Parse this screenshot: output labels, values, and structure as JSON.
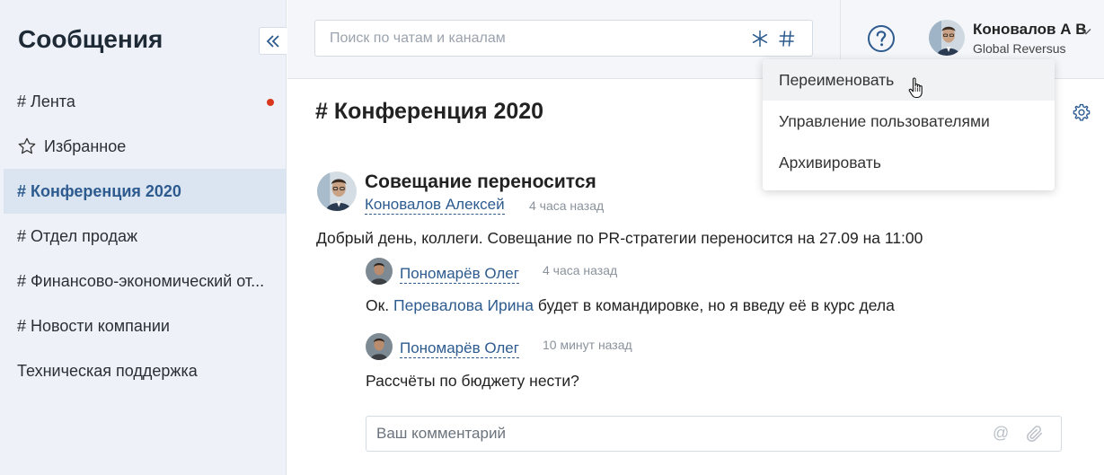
{
  "sidebar": {
    "title": "Сообщения",
    "collapse_icon": "double-chevron-left-icon",
    "items": [
      {
        "label": "# Лента",
        "unread": true
      },
      {
        "label": "Избранное",
        "icon": "star-icon"
      },
      {
        "label": "# Конференция 2020",
        "active": true
      },
      {
        "label": "# Отдел продаж"
      },
      {
        "label": "# Финансово-экономический от..."
      },
      {
        "label": "# Новости компании"
      },
      {
        "label": "Техническая поддержка"
      }
    ]
  },
  "header": {
    "search": {
      "placeholder": "Поиск по чатам и каналам",
      "icons": [
        "asterisk-icon",
        "hash-icon"
      ]
    },
    "help_icon": "question-circle-icon",
    "user": {
      "name": "Коновалов А В",
      "company": "Global Reversus"
    }
  },
  "channel": {
    "title": "# Конференция 2020",
    "settings_icon": "gear-icon"
  },
  "menu": {
    "items": [
      {
        "label": "Переименовать"
      },
      {
        "label": "Управление пользователями"
      },
      {
        "label": "Архивировать"
      }
    ]
  },
  "post": {
    "title": "Совещание переносится",
    "author": "Коновалов Алексей",
    "time": "4 часа назад",
    "text": "Добрый день, коллеги. Совещание по PR-стратегии переносится на 27.09 на 11:00"
  },
  "comments": [
    {
      "author": "Пономарёв Олег",
      "time": "4 часа назад",
      "text_before": "Ок.",
      "mention": "Перевалова Ирина",
      "text_after": "будет в командировке, но я введу её в курс дела"
    },
    {
      "author": "Пономарёв Олег",
      "time": "10 минут назад",
      "text": "Рассчёты по бюджету нести?"
    }
  ],
  "comment_box": {
    "placeholder": "Ваш комментарий",
    "mention_symbol": "@"
  },
  "colors": {
    "accent": "#2d5b8f",
    "unread": "#d9381e",
    "sidebar_bg": "#eef2f8",
    "active_bg": "#dbe5f1"
  }
}
